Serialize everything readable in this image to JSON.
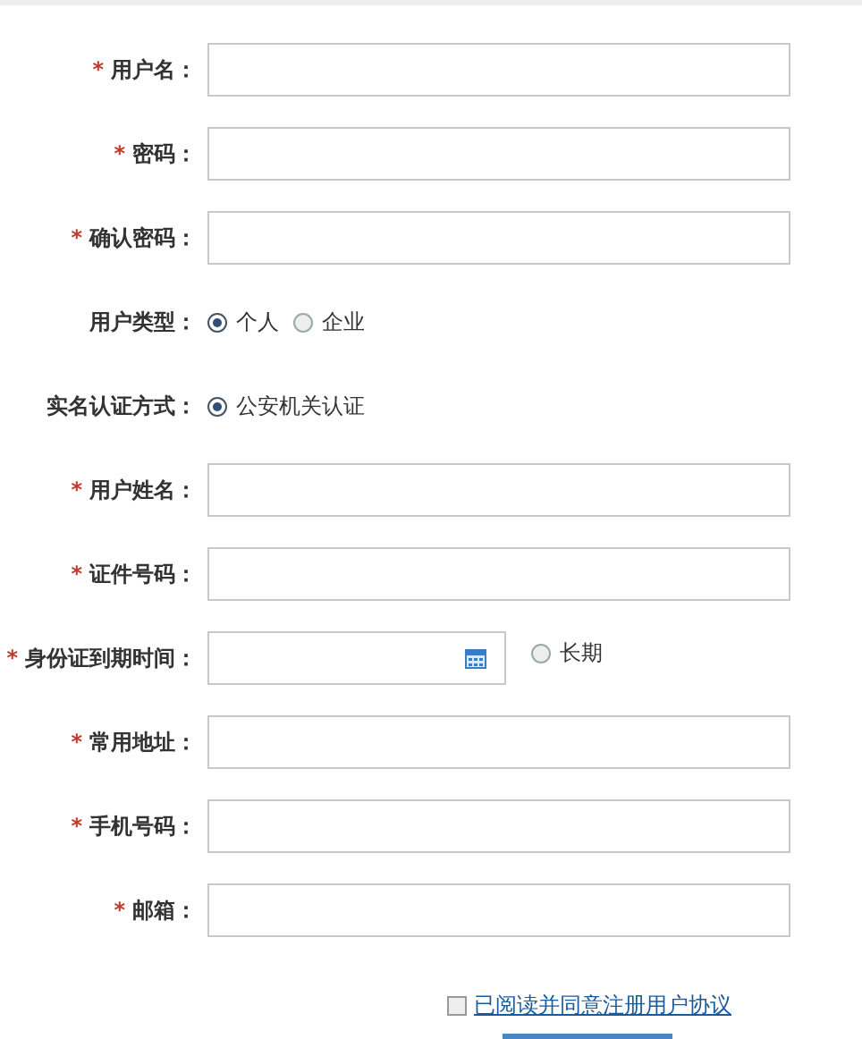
{
  "form": {
    "rows": [
      {
        "kind": "text",
        "mark": "*",
        "label": "用户名："
      },
      {
        "kind": "text",
        "mark": "*",
        "label": "密码："
      },
      {
        "kind": "text",
        "mark": "*",
        "label": "确认密码："
      },
      {
        "kind": "radio",
        "label": "用户类型：",
        "options": [
          {
            "label": "个人",
            "selected": true
          },
          {
            "label": "企业",
            "selected": false
          }
        ]
      },
      {
        "kind": "radio",
        "label": "实名认证方式：",
        "options": [
          {
            "label": "公安机关认证",
            "selected": true
          }
        ]
      },
      {
        "kind": "text",
        "mark": "*",
        "label": "用户姓名："
      },
      {
        "kind": "text",
        "mark": "*",
        "label": "证件号码："
      },
      {
        "kind": "date",
        "mark": "*",
        "label": "身份证到期时间：",
        "option": {
          "label": "长期",
          "selected": false
        }
      },
      {
        "kind": "text",
        "mark": "*",
        "label": "常用地址："
      },
      {
        "kind": "text",
        "mark": "*",
        "label": "手机号码："
      },
      {
        "kind": "text",
        "mark": "*",
        "label": "邮箱："
      }
    ]
  },
  "agreement": {
    "label": "已阅读并同意注册用户协议",
    "checked": false
  }
}
